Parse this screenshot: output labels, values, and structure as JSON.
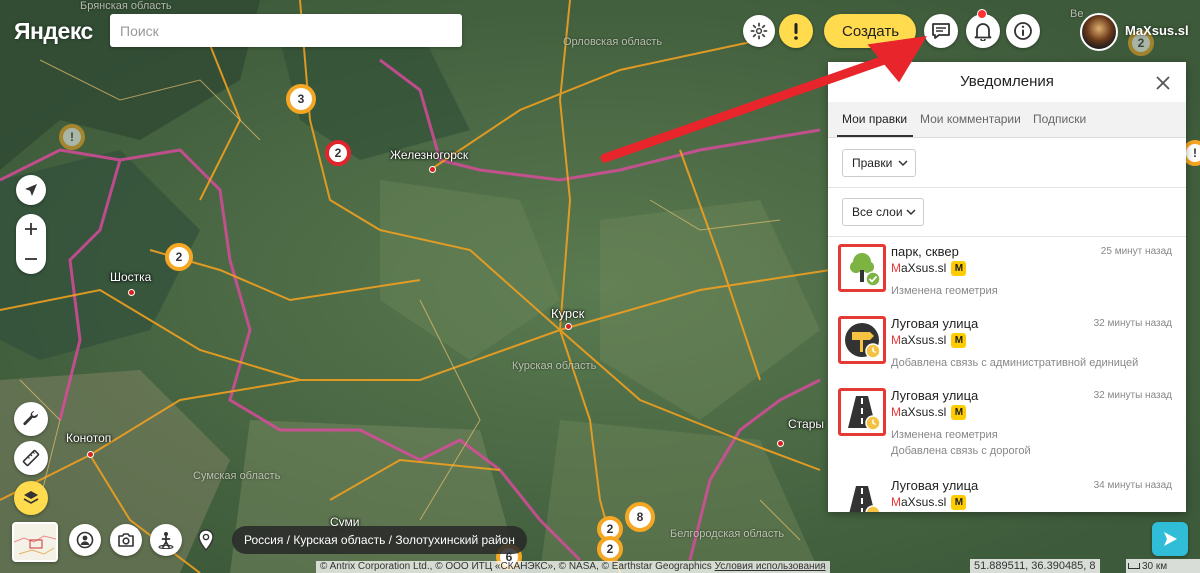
{
  "brand": {
    "logo_text": "Яндекс"
  },
  "search": {
    "placeholder": "Поиск"
  },
  "toolbar": {
    "settings_icon": "gear-icon",
    "alert_icon": "exclamation-icon",
    "create_label": "Создать",
    "comments_icon": "comment-icon",
    "notifications_icon": "bell-icon",
    "info_icon": "info-icon",
    "has_unread_notifications": true
  },
  "user": {
    "name": "MaXsus.sl"
  },
  "map": {
    "cities": [
      {
        "name": "Железногорск"
      },
      {
        "name": "Шостка"
      },
      {
        "name": "Курск"
      },
      {
        "name": "Конотоп"
      },
      {
        "name": "Суми"
      },
      {
        "name": "Стары"
      }
    ],
    "regions": [
      {
        "name": "Брянская область"
      },
      {
        "name": "Орловская область"
      },
      {
        "name": "Курская область"
      },
      {
        "name": "Сумская область"
      },
      {
        "name": "Белгородская область"
      },
      {
        "name": "Ве"
      }
    ],
    "clusters": [
      {
        "count": "3",
        "style": "orange"
      },
      {
        "count": "2",
        "style": "red"
      },
      {
        "count": "2",
        "style": "orange"
      },
      {
        "count": "2",
        "style": "dim"
      },
      {
        "count": "!",
        "style": "dim"
      },
      {
        "count": "8",
        "style": "orange"
      },
      {
        "count": "2",
        "style": "orange"
      },
      {
        "count": "2",
        "style": "orange"
      },
      {
        "count": "6",
        "style": "orange"
      },
      {
        "count": "!",
        "style": "orange"
      }
    ],
    "breadcrumb": "Россия / Курская область / Золотухинский район",
    "coordinates": "51.889511, 36.390485, 8",
    "scale_label": "30 км",
    "copyright": "© Antrix Corporation Ltd., © ООО ИТЦ «СКАНЭКС», © NASA, © Earthstar Geographics",
    "terms_link": "Условия использования"
  },
  "panel": {
    "title": "Уведомления",
    "tabs": [
      {
        "label": "Мои правки",
        "active": true
      },
      {
        "label": "Мои комментарии",
        "active": false
      },
      {
        "label": "Подписки",
        "active": false
      }
    ],
    "filter_edits": "Правки",
    "filter_layers": "Все слои",
    "items": [
      {
        "title": "парк, сквер",
        "time": "25 минут назад",
        "user_first": "M",
        "user_rest": "aXsus.sl",
        "badge": "M",
        "lines": [
          "Изменена геометрия"
        ],
        "icon": "tree-icon",
        "status_icon": "check-icon"
      },
      {
        "title": "Луговая улица",
        "time": "32 минуты назад",
        "user_first": "M",
        "user_rest": "aXsus.sl",
        "badge": "M",
        "lines": [
          "Добавлена связь с административной единицей"
        ],
        "icon": "street-sign-icon",
        "status_icon": "clock-icon"
      },
      {
        "title": "Луговая улица",
        "time": "32 минуты назад",
        "user_first": "M",
        "user_rest": "aXsus.sl",
        "badge": "M",
        "lines": [
          "Изменена геометрия",
          "Добавлена связь с дорогой"
        ],
        "icon": "road-icon",
        "status_icon": "clock-icon"
      },
      {
        "title": "Луговая улица",
        "time": "34 минуты назад",
        "user_first": "M",
        "user_rest": "aXsus.sl",
        "badge": "M",
        "lines": [],
        "icon": "road-icon",
        "status_icon": "clock-icon"
      }
    ]
  },
  "colors": {
    "accent_yellow": "#ffdb4d",
    "highlight_red": "#e53935",
    "cluster_orange": "#f5a623",
    "border_pink": "#e04aa0",
    "road_orange": "#f0a020"
  }
}
